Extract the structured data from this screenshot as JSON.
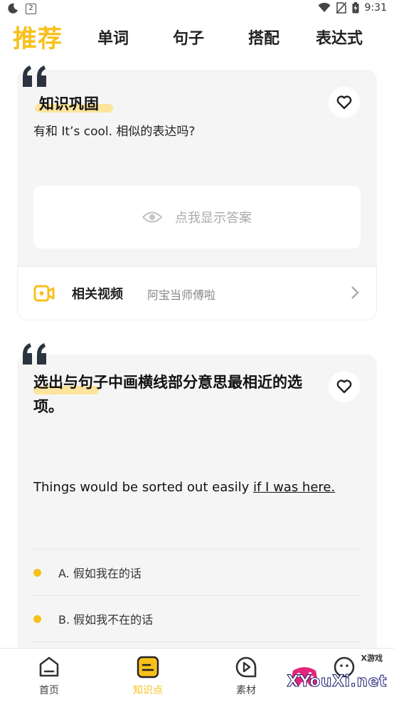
{
  "status_bar": {
    "sim_label": "2",
    "time": "9:31",
    "icons": [
      "moon-icon",
      "sim-icon",
      "wifi-icon",
      "no-sim-icon",
      "battery-icon"
    ]
  },
  "tabs": [
    {
      "label": "推荐",
      "active": true
    },
    {
      "label": "单词",
      "active": false
    },
    {
      "label": "句子",
      "active": false
    },
    {
      "label": "搭配",
      "active": false
    },
    {
      "label": "表达式",
      "active": false
    }
  ],
  "card1": {
    "title": "知识巩固",
    "question": "有和 It’s cool. 相似的表达吗?",
    "answer_button": "点我显示答案",
    "video": {
      "label": "相关视频",
      "author": "阿宝当师傅啦"
    }
  },
  "card2": {
    "title": "选出与句子中画横线部分意思最相近的选项。",
    "sentence_prefix": "Things would be sorted out easily ",
    "sentence_underlined": "if I was here.",
    "options": [
      {
        "label": "A. 假如我在的话"
      },
      {
        "label": "B. 假如我不在的话"
      }
    ]
  },
  "bottom_nav": [
    {
      "label": "首页",
      "icon": "home-icon",
      "active": false
    },
    {
      "label": "知识点",
      "icon": "notes-icon",
      "active": true
    },
    {
      "label": "素材",
      "icon": "play-circle-icon",
      "active": false
    },
    {
      "label": "",
      "icon": "face-icon",
      "active": false
    }
  ],
  "watermark": {
    "text": "XYouXi.net",
    "small": "X游戏"
  },
  "colors": {
    "accent": "#f8c01b",
    "highlight": "#fce49c",
    "card_bg": "#f5f5f5"
  }
}
